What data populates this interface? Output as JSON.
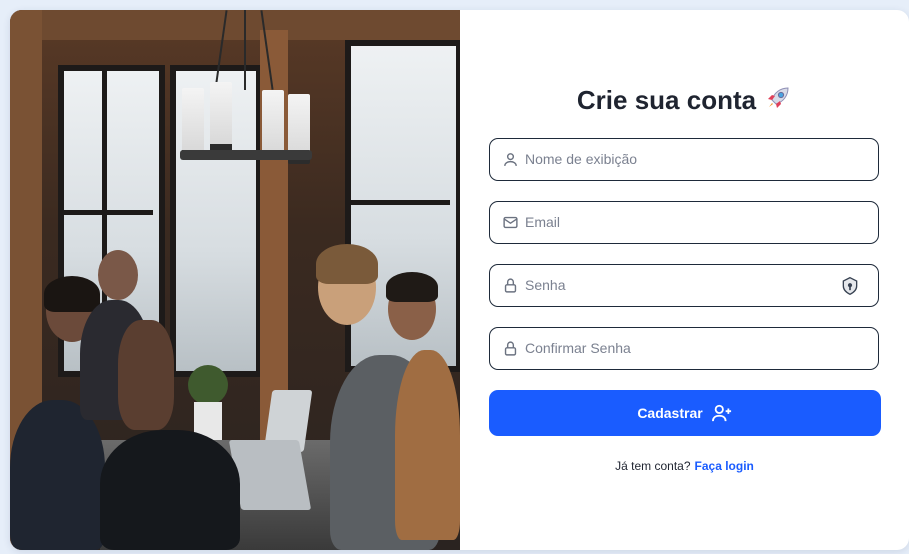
{
  "photo": {
    "alt_icon": "team-meeting-photo"
  },
  "form": {
    "title": "Crie sua conta",
    "title_emoji": "rocket-icon",
    "fields": [
      {
        "name": "display-name",
        "placeholder": "Nome de exibição",
        "icon": "user-icon",
        "value": ""
      },
      {
        "name": "email",
        "placeholder": "Email",
        "icon": "mail-icon",
        "value": ""
      },
      {
        "name": "password",
        "placeholder": "Senha",
        "icon": "lock-icon",
        "value": ""
      },
      {
        "name": "confirm-password",
        "placeholder": "Confirmar Senha",
        "icon": "lock-icon",
        "value": ""
      }
    ],
    "submit_label": "Cadastrar",
    "submit_icon": "user-plus-icon",
    "footer_text": "Já tem conta?",
    "footer_link": "Faça login"
  },
  "colors": {
    "accent": "#1a5cff",
    "field_border": "#1e2a3a",
    "background": "#e6eef9"
  }
}
